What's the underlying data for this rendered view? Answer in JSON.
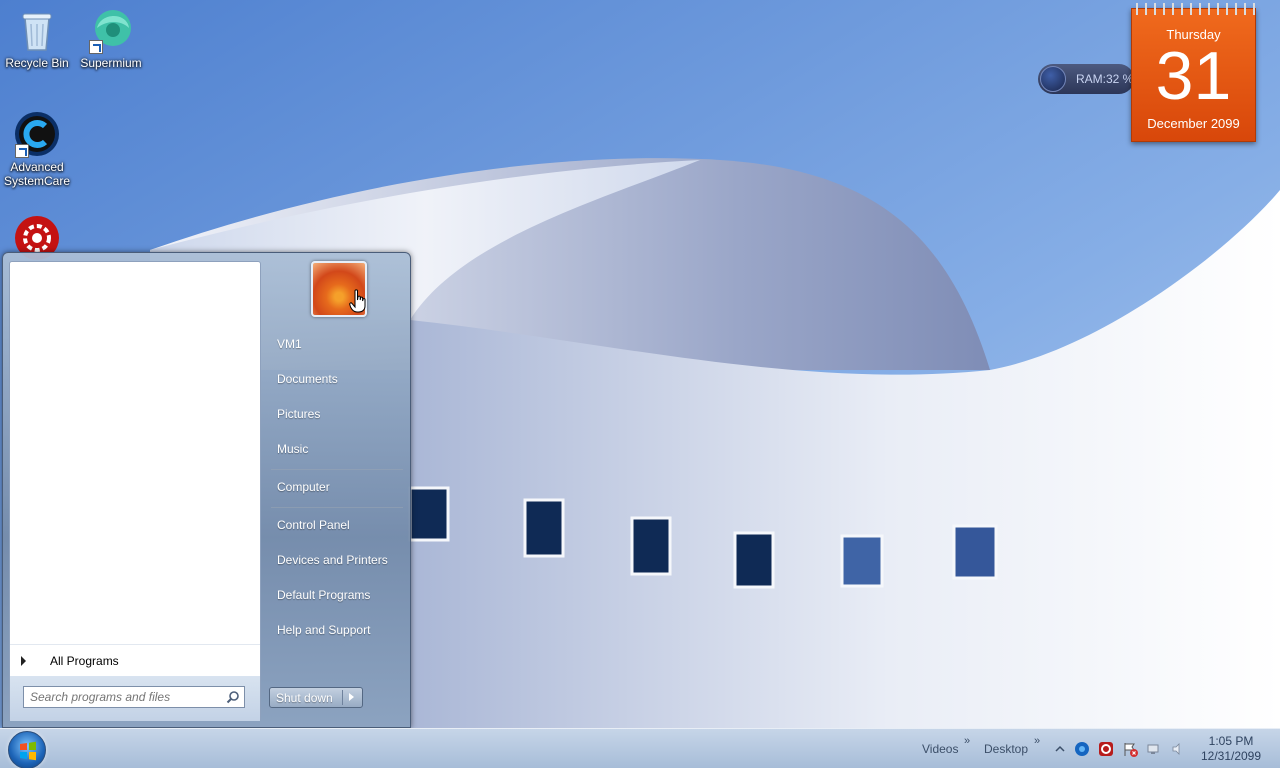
{
  "desktop": {
    "icons": [
      {
        "label": "Recycle Bin",
        "icon": "recycle-bin-icon"
      },
      {
        "label": "Supermium",
        "icon": "supermium-icon"
      },
      {
        "label": "Advanced SystemCare",
        "icon": "advanced-systemcare-icon"
      },
      {
        "label": "",
        "icon": "red-gear-icon"
      }
    ]
  },
  "gadgets": {
    "ram": {
      "text": "RAM:32 %"
    },
    "calendar": {
      "day_name": "Thursday",
      "day_num": "31",
      "month_year": "December 2099"
    }
  },
  "start_menu": {
    "all_programs": "All Programs",
    "search_placeholder": "Search programs and files",
    "right_items": [
      "VM1",
      "Documents",
      "Pictures",
      "Music",
      "Computer",
      "Control Panel",
      "Devices and Printers",
      "Default Programs",
      "Help and Support"
    ],
    "shutdown_label": "Shut down"
  },
  "taskbar": {
    "toolbars": [
      "Videos",
      "Desktop"
    ],
    "clock_time": "1:05 PM",
    "clock_date": "12/31/2099"
  },
  "colors": {
    "calendar": "#e85a12",
    "start_menu_glass": "#8aa2c2",
    "taskbar": "#b9cbe0"
  }
}
